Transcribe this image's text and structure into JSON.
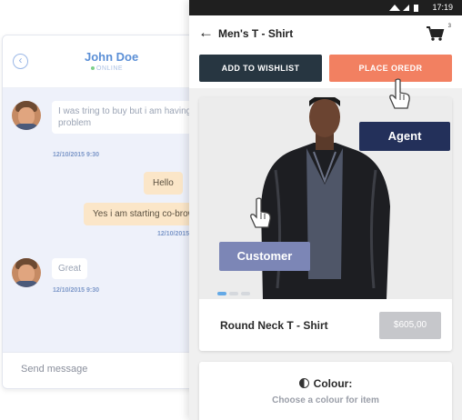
{
  "chat": {
    "back_icon": "chevron-left-icon",
    "contact_name": "John Doe",
    "status": "ONLINE",
    "messages": [
      {
        "from": "customer",
        "text": "I was tring to buy but i am having problem",
        "time": "12/10/2015 9:30"
      },
      {
        "from": "agent",
        "text": "Hello"
      },
      {
        "from": "agent",
        "text": "Yes i am starting co-brow",
        "time": "12/10/2015"
      },
      {
        "from": "customer",
        "text": "Great",
        "time": "12/10/2015 9:30"
      }
    ],
    "input_placeholder": "Send message"
  },
  "phone": {
    "status_time": "17:19",
    "title": "Men's T - Shirt",
    "cart_count": "3",
    "buttons": {
      "wishlist": "ADD TO WISHLIST",
      "order": "PLACE OREDR"
    },
    "product": {
      "name": "Round Neck T - Shirt",
      "price": "$605,00",
      "carousel_pages": 3,
      "carousel_active": 1
    },
    "colour": {
      "title": "Colour:",
      "subtitle": "Choose a colour for item"
    }
  },
  "overlays": {
    "agent_label": "Agent",
    "customer_label": "Customer"
  },
  "colors": {
    "wishlist_button": "#273641",
    "order_button": "#f28061",
    "agent_tag": "#23305a",
    "customer_tag": "#7c86b6",
    "chat_accent": "#5b8fd6"
  }
}
